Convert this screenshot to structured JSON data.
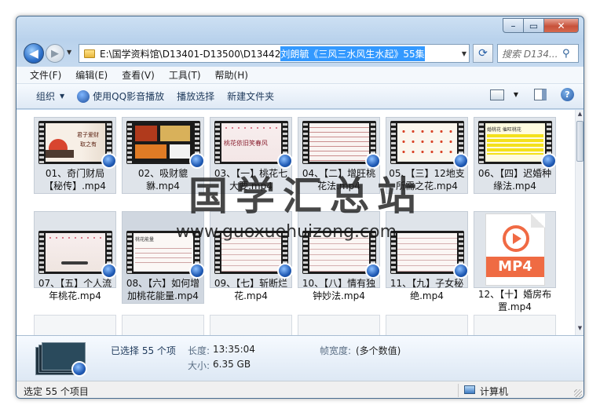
{
  "navbar": {
    "address_path": "E:\\国学资料馆\\D13401-D13500\\D13442",
    "address_selected": "刘朗毓《三风三水风生水起》55集",
    "search_placeholder": "搜索 D134..."
  },
  "menu": [
    "文件(F)",
    "编辑(E)",
    "查看(V)",
    "工具(T)",
    "帮助(H)"
  ],
  "toolbar": {
    "organize": "组织",
    "play_qq": "使用QQ影音播放",
    "play_selection": "播放选择",
    "new_folder": "新建文件夹"
  },
  "files": [
    "01、奇门财局【秘传】.mp4",
    "02、吸财貔貅.mp4",
    "03、【一】桃花七大要.mp4",
    "04、【二】增旺桃花法.mp4",
    "05、【三】12地支所需之花.mp4",
    "06、【四】迟婚种缘法.mp4",
    "07、【五】个人流年桃花.mp4",
    "08、【六】如何增加桃花能量.mp4",
    "09、【七】斩断烂花.mp4",
    "10、【八】情有独钟妙法.mp4",
    "11、【九】子女秘绝.mp4",
    "12、【十】婚房布置.mp4"
  ],
  "thumb_texts": {
    "t1_line1": "君子爱财",
    "t1_line2": "取之有",
    "t3": "桃花依旧笑春风",
    "t6": "婚桃花  催旺桃花",
    "t8": "桃花能量",
    "mp4_badge": "MP4"
  },
  "watermark": {
    "cn": "国学汇总站",
    "url": "www.guoxuehuizong.com"
  },
  "details": {
    "selected": "已选择 55 个项",
    "duration_label": "长度:",
    "duration": "13:35:04",
    "size_label": "大小:",
    "size": "6.35 GB",
    "framewidth_label": "帧宽度:",
    "framewidth": "(多个数值)"
  },
  "status": {
    "left": "选定 55 个项目",
    "right": "计算机"
  },
  "colors": {
    "selection": "#3399ff",
    "mp4_orange": "#ef6b43",
    "qq_blue": "#1f5ab5"
  }
}
